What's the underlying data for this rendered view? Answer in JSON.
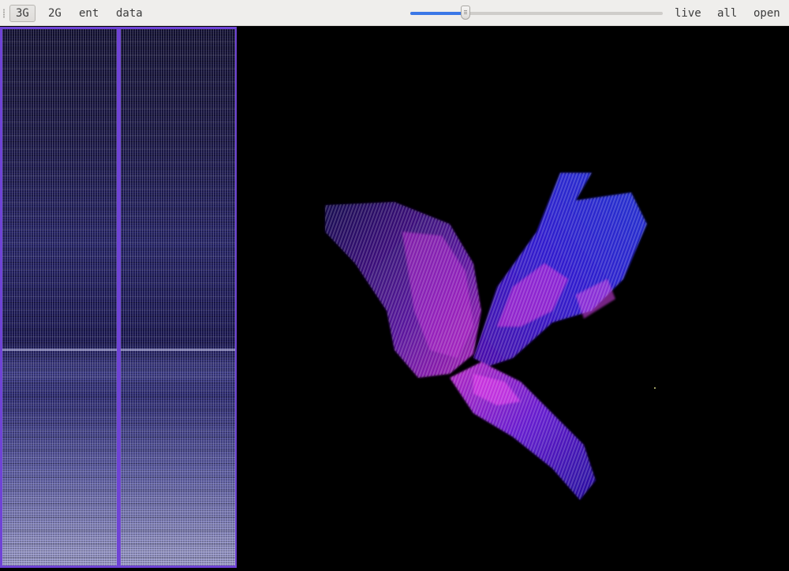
{
  "toolbar": {
    "tabs": [
      {
        "label": "3G",
        "active": true
      },
      {
        "label": "2G",
        "active": false
      },
      {
        "label": "ent",
        "active": false
      },
      {
        "label": "data",
        "active": false
      }
    ],
    "slider": {
      "value": 0.22
    },
    "actions": [
      {
        "label": "live"
      },
      {
        "label": "all"
      },
      {
        "label": "open"
      }
    ]
  },
  "colors": {
    "panel_border": "#6f43d6",
    "viz_background": "#000000",
    "accent_magenta": "#e020e8",
    "accent_blue": "#3a1fff",
    "slider_fill": "#3b78e7"
  }
}
